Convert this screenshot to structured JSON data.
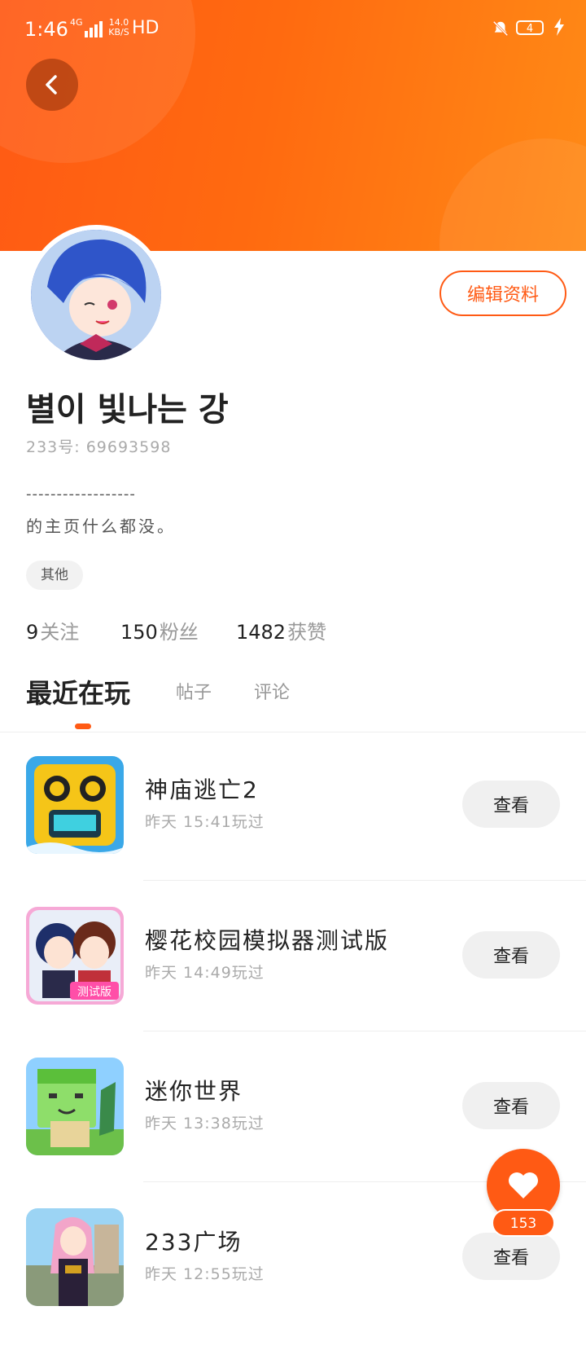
{
  "status_bar": {
    "time": "1:46",
    "network": "4G",
    "speed": "14.0 KB/S",
    "hd": "HD",
    "battery": "4"
  },
  "profile": {
    "edit_label": "编辑资料",
    "username": "별이 빛나는 강",
    "uid": "233号:  69693598",
    "bio_line1": "------------------",
    "bio_line2": "的主页什么都没。",
    "tag": "其他",
    "stats": [
      {
        "num": "9",
        "label": "关注"
      },
      {
        "num": "150",
        "label": "粉丝"
      },
      {
        "num": "1482",
        "label": "获赞"
      }
    ]
  },
  "tabs": [
    {
      "label": "最近在玩",
      "active": true
    },
    {
      "label": "帖子",
      "active": false
    },
    {
      "label": "评论",
      "active": false
    }
  ],
  "games": [
    {
      "name": "神庙逃亡2",
      "time": "昨天 15:41玩过",
      "button": "查看",
      "icon": "temple-run-icon"
    },
    {
      "name": "樱花校园模拟器测试版",
      "time": "昨天 14:49玩过",
      "button": "查看",
      "icon": "sakura-school-icon"
    },
    {
      "name": "迷你世界",
      "time": "昨天 13:38玩过",
      "button": "查看",
      "icon": "mini-world-icon"
    },
    {
      "name": "233广场",
      "time": "昨天 12:55玩过",
      "button": "查看",
      "icon": "233-plaza-icon"
    }
  ],
  "fab": {
    "count": "153",
    "icon": "heart-icon"
  },
  "colors": {
    "accent": "#ff5a14",
    "header_gradient_end": "#ff8a16"
  }
}
